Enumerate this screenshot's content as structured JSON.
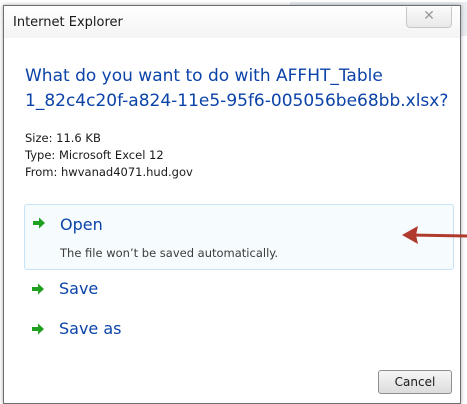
{
  "window": {
    "title": "Internet Explorer",
    "close_glyph": "✕"
  },
  "prompt": {
    "line1": "What do you want to do with AFFHT_Table",
    "line2": "1_82c4c20f-a824-11e5-95f6-005056be68bb.xlsx?"
  },
  "file_info": {
    "size": "Size: 11.6 KB",
    "type": "Type: Microsoft Excel 12",
    "from": "From: hwvanad4071.hud.gov"
  },
  "options": [
    {
      "label": "Open",
      "sub": "The file won’t be saved automatically.",
      "icon": "green-arrow-icon",
      "highlighted": true
    },
    {
      "label": "Save",
      "icon": "green-arrow-icon"
    },
    {
      "label": "Save as",
      "icon": "green-arrow-icon"
    }
  ],
  "buttons": {
    "cancel": "Cancel"
  },
  "colors": {
    "link_blue": "#0b43a8",
    "arrow_green": "#1fa01f",
    "annotation_red": "#b03a2e",
    "highlight_border": "#c7e3f5"
  }
}
